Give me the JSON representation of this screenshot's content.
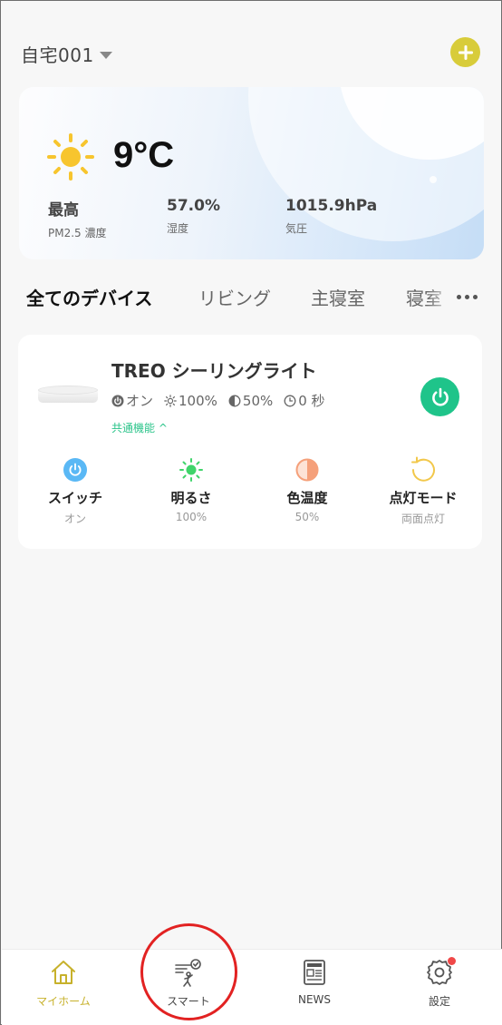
{
  "header": {
    "home_name": "自宅001",
    "icons": {
      "dropdown": "caret-down-icon",
      "add": "plus-circle-icon"
    }
  },
  "weather": {
    "icon": "sun-icon",
    "temperature": "9°C",
    "stats": [
      {
        "value": "最高",
        "label": "PM2.5 濃度"
      },
      {
        "value": "57.0%",
        "label": "湿度"
      },
      {
        "value": "1015.9hPa",
        "label": "気圧"
      }
    ]
  },
  "tabs": {
    "items": [
      {
        "label": "全てのデバイス"
      },
      {
        "label": "リビング"
      },
      {
        "label": "主寝室"
      },
      {
        "label": "寝室"
      }
    ],
    "active_index": 0,
    "more_icon": "more-dots-icon"
  },
  "device": {
    "name": "TREO シーリングライト",
    "status": {
      "power": "オン",
      "brightness": "100%",
      "color_temp": "50%",
      "timer": "0 秒"
    },
    "common_func": "共通機能 ^",
    "power_button_icon": "power-icon",
    "controls": [
      {
        "label": "スイッチ",
        "value": "オン",
        "icon": "power-icon",
        "color": "#5ab8f5"
      },
      {
        "label": "明るさ",
        "value": "100%",
        "icon": "brightness-icon",
        "color": "#3fd46a"
      },
      {
        "label": "色温度",
        "value": "50%",
        "icon": "color-temperature-icon",
        "color": "#f5a07a"
      },
      {
        "label": "点灯モード",
        "value": "両面点灯",
        "icon": "mode-cycle-icon",
        "color": "#f2c84b"
      }
    ]
  },
  "bottom_nav": {
    "items": [
      {
        "label": "マイホーム",
        "icon": "home-icon"
      },
      {
        "label": "スマート",
        "icon": "smart-scene-icon"
      },
      {
        "label": "NEWS",
        "icon": "news-icon"
      },
      {
        "label": "設定",
        "icon": "gear-icon"
      }
    ],
    "active_index": 0
  },
  "colors": {
    "accent": "#c7b12b",
    "add_button": "#d8cc3a",
    "power_on": "#1fc48a",
    "highlight": "#e22222",
    "badge": "#f04848"
  }
}
